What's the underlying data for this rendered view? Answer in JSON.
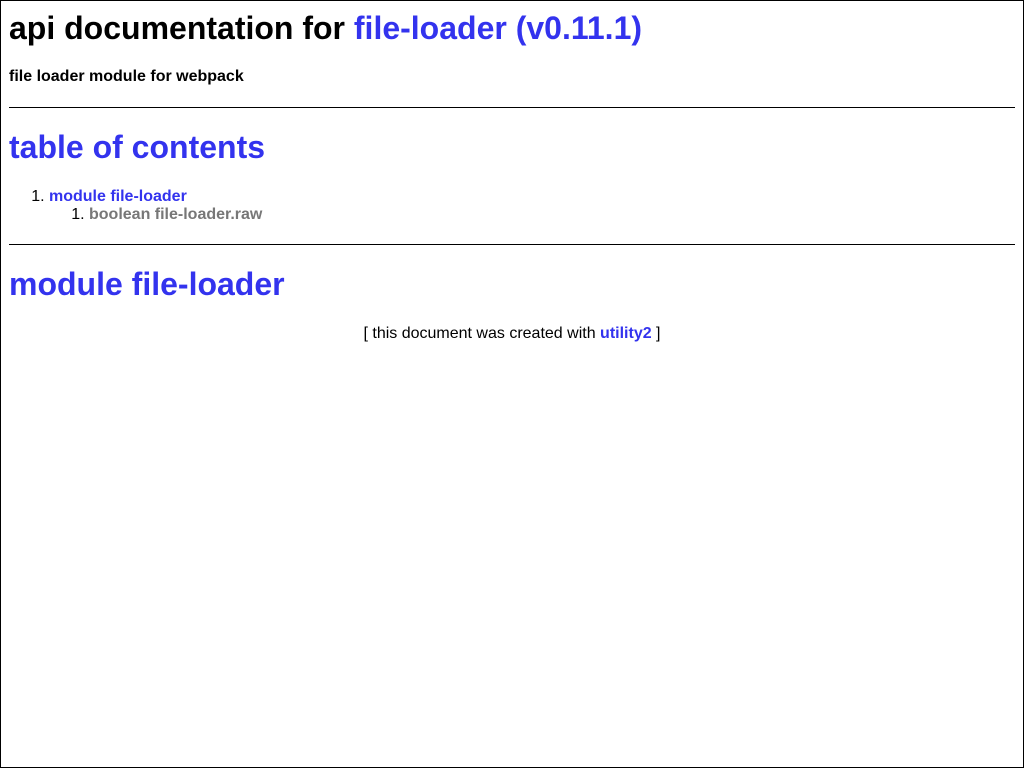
{
  "header": {
    "title_prefix": "api documentation for ",
    "title_link": "file-loader (v0.11.1)",
    "description": "file loader module for webpack"
  },
  "toc": {
    "title": "table of contents",
    "items": [
      {
        "number": "1.",
        "label": "module file-loader",
        "children": [
          {
            "number": "1.",
            "label": "boolean file-loader.raw"
          }
        ]
      }
    ]
  },
  "module": {
    "title": "module file-loader"
  },
  "footer": {
    "prefix": "[ this document was created with ",
    "link": "utility2",
    "suffix": " ]"
  },
  "colors": {
    "link": "#3333ee",
    "muted": "#777777"
  }
}
